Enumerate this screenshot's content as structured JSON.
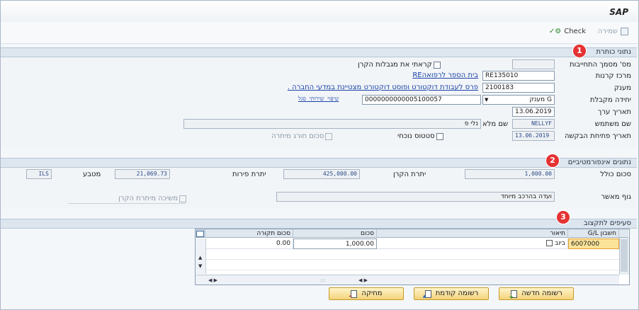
{
  "app": {
    "title": "SAP"
  },
  "toolbar": {
    "save_label": "שמירה",
    "check_label": "Check"
  },
  "sections": {
    "header_data": {
      "title": "נתוני כותרת",
      "badge": "1"
    },
    "info_data": {
      "title": "נתונים אינפורמטיביים",
      "badge": "2"
    },
    "budget_items": {
      "title": "סעיפים לתקצוב",
      "badge": "3"
    }
  },
  "header": {
    "commitment_doc_label": "מס' מסמך התחייבות",
    "commitment_doc_value": "",
    "read_fund_limits_label": "קראתי את מגבלות הקרן",
    "fund_center_label": "מרכז קרנות",
    "fund_center_value": "RE135010",
    "fund_center_desc": "בית הספר לרפואהRE",
    "grant_label": "מענק",
    "grant_value": "2100183",
    "grant_desc": "פרס לעבודת דוקטורט ופוסט דוקטורט מצטיינת במדעי החברה .",
    "receiving_unit_label": "יחידה מקבלת",
    "receiving_unit_select": "G מענק",
    "receiving_unit_value": "0000000000005100057",
    "receiving_unit_desc": "שיפוי שירותי סגל",
    "value_date_label": "תאריך ערך",
    "value_date_value": "13.06.2019",
    "username_label": "שם משתמש",
    "username_value": "NELLYF",
    "fullname_label": "שם מלא",
    "fullname_value": "נלי פ",
    "request_open_date_label": "תאריך פתיחת הבקשה",
    "request_open_date_value": "13.06.2019",
    "current_status_label": "סטטוס נוכחי",
    "over_remaining_label": "סכום חורג מיתרה"
  },
  "info": {
    "total_amount_label": "סכום כולל",
    "total_amount_value": "1,000.00",
    "fund_balance_label": "יתרת הקרן",
    "fund_balance_value": "425,000.00",
    "sources_balance_label": "יתרת פירות",
    "sources_balance_value": "21,069.73",
    "currency_label": "מטבע",
    "currency_value": "ILS",
    "approving_body_label": "גוף מאשר",
    "approving_body_value": "ועדה בהרכב מיוחד",
    "withdraw_balance_label": "משיכה מיתרת הקרן"
  },
  "grid": {
    "columns": {
      "gl": "חשבון G/L",
      "desc": "תיאור",
      "amount": "סכום",
      "original": "סכום תקורה"
    },
    "rows": [
      {
        "gl": "6007000",
        "desc": "ביוב",
        "amount": "1,000.00",
        "original": "0.00"
      }
    ]
  },
  "buttons": {
    "new_record": "רשומה חדשה",
    "prev_record": "רשומה קודמת",
    "delete": "מחיקה"
  }
}
